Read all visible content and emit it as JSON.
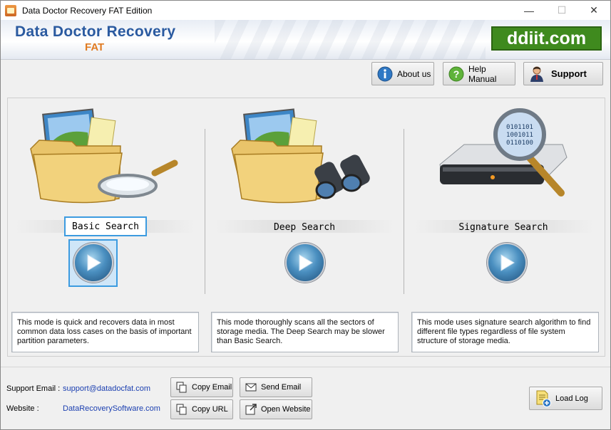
{
  "window": {
    "title": "Data Doctor Recovery FAT Edition",
    "controls": {
      "minimize": "—",
      "maximize": "☐",
      "close": "✕"
    }
  },
  "banner": {
    "brand_title": "Data Doctor Recovery",
    "brand_subtitle": "FAT",
    "site_logo": "ddiit.com"
  },
  "toolbar": {
    "about_label": "About us",
    "help_label": "Help Manual",
    "support_label": "Support"
  },
  "modes": [
    {
      "label": "Basic Search",
      "selected": true,
      "description": "This mode is quick and recovers data in most common data loss cases on the basis of important partition parameters."
    },
    {
      "label": "Deep Search",
      "selected": false,
      "description": "This mode thoroughly scans all the sectors of storage media. The Deep Search may be slower than Basic Search."
    },
    {
      "label": "Signature Search",
      "selected": false,
      "description": "This mode uses signature search algorithm to find different file types regardless of file system structure of storage media."
    }
  ],
  "footer": {
    "support_email_label": "Support Email :",
    "support_email": "support@datadocfat.com",
    "website_label": "Website :",
    "website": "DataRecoverySoftware.com",
    "copy_email": "Copy Email",
    "send_email": "Send Email",
    "copy_url": "Copy URL",
    "open_website": "Open Website",
    "load_log": "Load Log"
  },
  "colors": {
    "brand_blue": "#2a5aa0",
    "brand_orange": "#e07b22",
    "logo_green": "#3f8a1e",
    "selection_blue": "#3c9be0",
    "link_blue": "#1b3fb0"
  },
  "icons": [
    "app-icon",
    "info-icon",
    "help-icon",
    "support-person-icon",
    "folder-magnifier-icon",
    "folder-binoculars-icon",
    "drive-magnifier-icon",
    "play-icon",
    "copy-icon",
    "mail-icon",
    "open-website-icon",
    "load-log-icon"
  ]
}
